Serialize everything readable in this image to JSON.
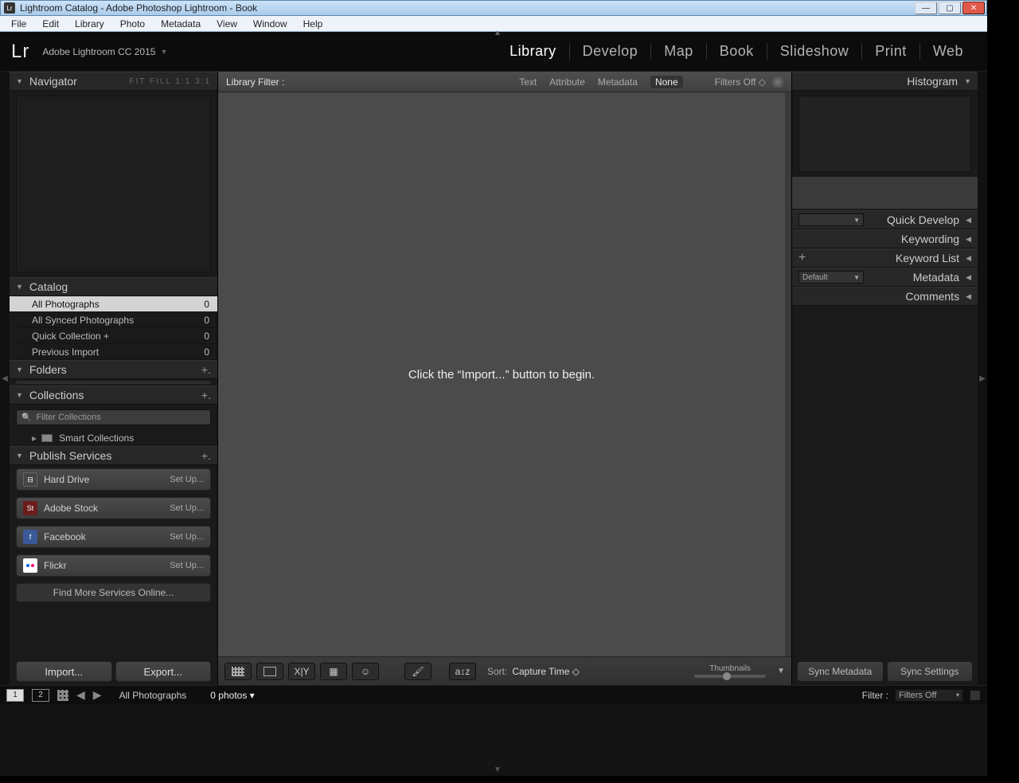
{
  "window": {
    "title": "Lightroom Catalog - Adobe Photoshop Lightroom - Book",
    "icon_label": "Lr"
  },
  "menu": [
    "File",
    "Edit",
    "Library",
    "Photo",
    "Metadata",
    "View",
    "Window",
    "Help"
  ],
  "identity": {
    "logo": "Lr",
    "product": "Adobe Lightroom CC 2015"
  },
  "modules": [
    "Library",
    "Develop",
    "Map",
    "Book",
    "Slideshow",
    "Print",
    "Web"
  ],
  "active_module": "Library",
  "navigator": {
    "title": "Navigator",
    "opts": "FIT   FILL   1:1   3:1"
  },
  "catalog": {
    "title": "Catalog",
    "items": [
      {
        "label": "All Photographs",
        "count": "0",
        "selected": true
      },
      {
        "label": "All Synced Photographs",
        "count": "0",
        "selected": false
      },
      {
        "label": "Quick Collection  +",
        "count": "0",
        "selected": false
      },
      {
        "label": "Previous Import",
        "count": "0",
        "selected": false
      }
    ]
  },
  "folders": {
    "title": "Folders"
  },
  "collections": {
    "title": "Collections",
    "search_placeholder": "Filter Collections",
    "tree_item": "Smart Collections"
  },
  "publish": {
    "title": "Publish Services",
    "services": [
      {
        "label": "Hard Drive",
        "setup": "Set Up...",
        "cls": "hd"
      },
      {
        "label": "Adobe Stock",
        "setup": "Set Up...",
        "cls": "st",
        "glyph": "St"
      },
      {
        "label": "Facebook",
        "setup": "Set Up...",
        "cls": "fb",
        "glyph": "f"
      },
      {
        "label": "Flickr",
        "setup": "Set Up...",
        "cls": "fl"
      }
    ],
    "find_more": "Find More Services Online..."
  },
  "ie": {
    "import": "Import...",
    "export": "Export..."
  },
  "filterbar": {
    "label": "Library Filter :",
    "tabs": [
      "Text",
      "Attribute",
      "Metadata",
      "None"
    ],
    "selected": "None",
    "filters_state": "Filters Off ◇"
  },
  "canvas_message": "Click the “Import...” button to begin.",
  "toolbar": {
    "sort_label": "Sort:",
    "sort_value": "Capture Time  ◇",
    "thumb_label": "Thumbnails"
  },
  "right": {
    "histogram": "Histogram",
    "sections": [
      "Quick Develop",
      "Keywording",
      "Keyword List",
      "Metadata",
      "Comments"
    ],
    "preset_label": "Default"
  },
  "sync": {
    "meta": "Sync Metadata",
    "settings": "Sync Settings"
  },
  "filmstrip": {
    "path": "All Photographs",
    "count_label": "0 photos  ▾",
    "filter_label": "Filter :",
    "filter_value": "Filters Off",
    "screen1": "1",
    "screen2": "2"
  }
}
